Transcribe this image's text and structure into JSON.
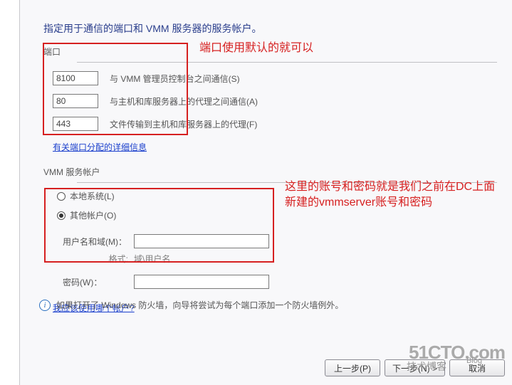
{
  "heading": "指定用于通信的端口和 VMM 服务器的服务帐户。",
  "ports": {
    "label": "端口",
    "rows": [
      {
        "value": "8100",
        "label": "与 VMM 管理员控制台之间通信(S)"
      },
      {
        "value": "80",
        "label": "与主机和库服务器上的代理之间通信(A)"
      },
      {
        "value": "443",
        "label": "文件传输到主机和库服务器上的代理(F)"
      }
    ],
    "link": "有关端口分配的详细信息"
  },
  "service_account": {
    "title": "VMM 服务帐户",
    "radio_local": "本地系统(L)",
    "radio_other": "其他帐户(O)",
    "selected": "other",
    "username_label": "用户名和域(M)：",
    "username_value": "",
    "format_hint_label": "格式:",
    "format_hint_value": "域\\用户名",
    "password_label": "密码(W)：",
    "password_value": "",
    "help_link": "我应该使用哪个帐户?"
  },
  "firewall_hint": "如果打开了 Windows 防火墙，向导将尝试为每个端口添加一个防火墙例外。",
  "buttons": {
    "back": "上一步(P)",
    "next": "下一步(N) >",
    "cancel": "取消"
  },
  "annotations": {
    "a1": "端口使用默认的就可以",
    "a2": "这里的账号和密码就是我们之前在DC上面新建的vmmserver账号和密码"
  },
  "watermark": {
    "big": "51CTO.com",
    "small": "技术博客",
    "tiny1": "Blog",
    "tiny2": "取消"
  }
}
